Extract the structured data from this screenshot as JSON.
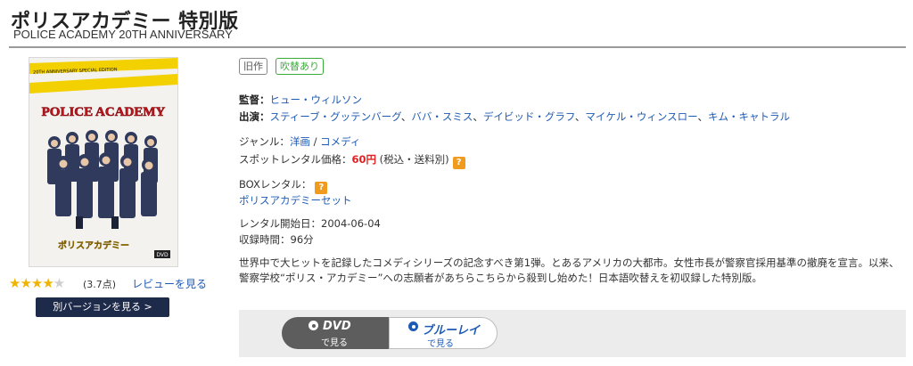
{
  "header": {
    "title": "ポリスアカデミー 特別版",
    "subtitle": "POLICE ACADEMY 20TH ANNIVERSARY"
  },
  "poster": {
    "tape_text": "20TH ANNIVERSARY SPECIAL EDITION",
    "logo_text": "POLICE ACADEMY",
    "jp_logo": "ポリスアカデミー",
    "badge": "DVD"
  },
  "rating": {
    "stars_filled": "★★★★",
    "stars_empty": "★",
    "value": 3.7,
    "score_text": "(3.7点)",
    "review_link": "レビューを見る"
  },
  "other_version_button": "別バージョンを見る >",
  "tags": {
    "old": "旧作",
    "dubbed": "吹替あり"
  },
  "director": {
    "label": "監督：",
    "name": "ヒュー・ウィルソン"
  },
  "cast": {
    "label": "出演：",
    "names": [
      "スティーブ・グッテンバーグ",
      "ババ・スミス",
      "デイビッド・グラフ",
      "マイケル・ウィンスロー",
      "キム・キャトラル"
    ],
    "separator": "、"
  },
  "genre": {
    "label": "ジャンル：",
    "primary": "洋画",
    "slash": " / ",
    "secondary": "コメディ"
  },
  "spot_rental": {
    "label": "スポットレンタル価格：",
    "price": "60円",
    "tax_note": " (税込・送料別)",
    "help_icon": "?"
  },
  "box_rental": {
    "label": "BOXレンタル：",
    "help_icon": "?",
    "set_link": "ポリスアカデミーセット"
  },
  "rental_start": {
    "label": "レンタル開始日：",
    "value": "2004-06-04"
  },
  "runtime": {
    "label": "収録時間：",
    "value": "96分"
  },
  "description": "世界中で大ヒットを記録したコメディシリーズの記念すべき第1弾。とあるアメリカの大都市。女性市長が警察官採用基準の撤廃を宣言。以来、警察学校“ポリス・アカデミー”への志願者があちらこちらから殺到し始めた！日本語吹替えを初収録した特別版。",
  "formats": {
    "dvd": {
      "title": "DVD",
      "sub": "で見る"
    },
    "bluray": {
      "title": "ブルーレイ",
      "sub": "で見る"
    }
  },
  "colors": {
    "link": "#1d5ab5",
    "price": "#e02020",
    "star": "#f0b400",
    "dubbed": "#3aab3a",
    "button_dark": "#1e2a4a"
  }
}
